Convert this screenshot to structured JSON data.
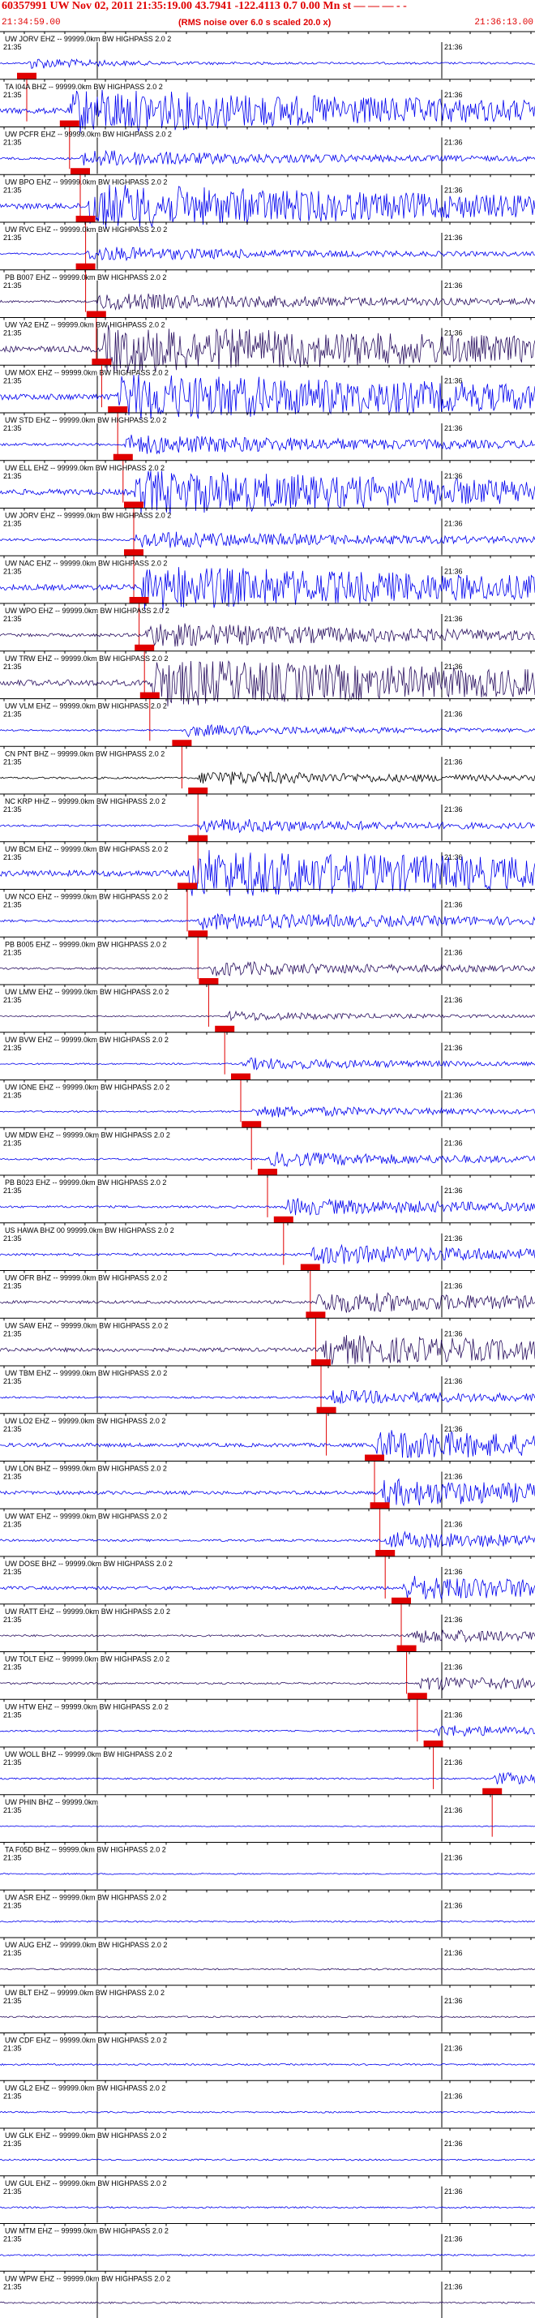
{
  "header": {
    "title": "60357991 UW Nov 02, 2011 21:35:19.00   43.7941 -122.4113  0.7 0.00 Mn st — — — - -",
    "subtitle": "(RMS noise over 6.0 s scaled 20.0 x)",
    "start_time": "21:34:59.00",
    "end_time": "21:36:13.00"
  },
  "colors": {
    "trace_blue": "#0000ee",
    "trace_dark": "#2a1060",
    "trace_black": "#000000",
    "pick": "#e00000",
    "axis": "#000000"
  },
  "tick_labels": {
    "left": "21:35",
    "right": "21:36"
  },
  "channels": [
    {
      "label": "UW JORV EHZ -- 99999.0km BW  HIGHPASS  2.0  2",
      "pick": 0.05,
      "amp": 0.25,
      "burst": 0.5
    },
    {
      "label": "TA I04A BHZ -- 99999.0km BW  HIGHPASS  2.0  2",
      "pick": 0.13,
      "amp": 0.9,
      "burst": 3.0
    },
    {
      "label": "UW PCFR EHZ -- 99999.0km BW  HIGHPASS  2.0  2",
      "pick": 0.15,
      "amp": 0.35,
      "burst": 1.5
    },
    {
      "label": "UW BPO EHZ -- 99999.0km BW  HIGHPASS  2.0  2",
      "pick": 0.16,
      "amp": 0.9,
      "burst": 3.0
    },
    {
      "label": "UW RVC EHZ -- 99999.0km BW  HIGHPASS  2.0  2",
      "pick": 0.16,
      "amp": 0.3,
      "burst": 1.5
    },
    {
      "label": "PB B007 EHZ -- 99999.0km BW  HIGHPASS  2.0  2",
      "pick": 0.18,
      "amp": 0.35,
      "burst": 2.0
    },
    {
      "label": "UW YA2 EHZ -- 99999.0km BW  HIGHPASS  2.0  2",
      "pick": 0.19,
      "amp": 0.95,
      "burst": 3.5
    },
    {
      "label": "UW MOX EHZ -- 99999.0km BW  HIGHPASS  2.0  2",
      "pick": 0.22,
      "amp": 0.95,
      "burst": 3.5
    },
    {
      "label": "UW STD EHZ -- 99999.0km BW  HIGHPASS  2.0  2",
      "pick": 0.23,
      "amp": 0.4,
      "burst": 2.0
    },
    {
      "label": "UW ELL EHZ -- 99999.0km BW  HIGHPASS  2.0  2",
      "pick": 0.25,
      "amp": 0.9,
      "burst": 3.0
    },
    {
      "label": "UW JORV EHZ -- 99999.0km BW  HIGHPASS  2.0  2",
      "pick": 0.25,
      "amp": 0.35,
      "burst": 1.8
    },
    {
      "label": "UW NAC EHZ -- 99999.0km BW  HIGHPASS  2.0  2",
      "pick": 0.26,
      "amp": 0.9,
      "burst": 3.0
    },
    {
      "label": "UW WPO EHZ -- 99999.0km BW  HIGHPASS  2.0  2",
      "pick": 0.27,
      "amp": 0.5,
      "burst": 2.0
    },
    {
      "label": "UW TRW EHZ -- 99999.0km BW  HIGHPASS  2.0  2",
      "pick": 0.28,
      "amp": 0.95,
      "burst": 3.5
    },
    {
      "label": "UW VLM EHZ -- 99999.0km BW  HIGHPASS  2.0  2",
      "pick": 0.34,
      "amp": 0.25,
      "burst": 1.2
    },
    {
      "label": "CN PNT BHZ -- 99999.0km BW  HIGHPASS  2.0  2",
      "pick": 0.37,
      "amp": 0.3,
      "burst": 1.5
    },
    {
      "label": "NC KRP HHZ -- 99999.0km BW  HIGHPASS  2.0  2",
      "pick": 0.37,
      "amp": 0.3,
      "burst": 1.5
    },
    {
      "label": "UW BCM EHZ -- 99999.0km BW  HIGHPASS  2.0  2",
      "pick": 0.35,
      "amp": 0.95,
      "burst": 4.0
    },
    {
      "label": "UW NCO EHZ -- 99999.0km BW  HIGHPASS  2.0  2",
      "pick": 0.37,
      "amp": 0.35,
      "burst": 2.0
    },
    {
      "label": "PB B005 EHZ -- 99999.0km BW  HIGHPASS  2.0  2",
      "pick": 0.39,
      "amp": 0.3,
      "burst": 1.5
    },
    {
      "label": "UW LMW EHZ -- 99999.0km BW  HIGHPASS  2.0  2",
      "pick": 0.42,
      "amp": 0.2,
      "burst": 1.0
    },
    {
      "label": "UW BVW EHZ -- 99999.0km BW  HIGHPASS  2.0  2",
      "pick": 0.45,
      "amp": 0.25,
      "burst": 1.2
    },
    {
      "label": "UW IONE EHZ -- 99999.0km BW  HIGHPASS  2.0  2",
      "pick": 0.47,
      "amp": 0.25,
      "burst": 1.3
    },
    {
      "label": "UW MDW EHZ -- 99999.0km BW  HIGHPASS  2.0  2",
      "pick": 0.5,
      "amp": 0.3,
      "burst": 1.5
    },
    {
      "label": "PB B023 EHZ -- 99999.0km BW  HIGHPASS  2.0  2",
      "pick": 0.53,
      "amp": 0.35,
      "burst": 1.6
    },
    {
      "label": "US HAWA BHZ 00 99999.0km BW  HIGHPASS  2.0  2",
      "pick": 0.58,
      "amp": 0.4,
      "burst": 1.8
    },
    {
      "label": "UW OFR BHZ -- 99999.0km BW  HIGHPASS  2.0  2",
      "pick": 0.59,
      "amp": 0.45,
      "burst": 1.8
    },
    {
      "label": "UW SAW EHZ -- 99999.0km BW  HIGHPASS  2.0  2",
      "pick": 0.6,
      "amp": 0.6,
      "burst": 2.5
    },
    {
      "label": "UW TBM EHZ -- 99999.0km BW  HIGHPASS  2.0  2",
      "pick": 0.61,
      "amp": 0.3,
      "burst": 1.4
    },
    {
      "label": "UW LO2 EHZ -- 99999.0km BW  HIGHPASS  2.0  2",
      "pick": 0.7,
      "amp": 0.6,
      "burst": 2.2
    },
    {
      "label": "UW LON BHZ -- 99999.0km BW  HIGHPASS  2.0  2",
      "pick": 0.71,
      "amp": 0.55,
      "burst": 2.0
    },
    {
      "label": "UW WAT EHZ -- 99999.0km BW  HIGHPASS  2.0  2",
      "pick": 0.72,
      "amp": 0.35,
      "burst": 1.6
    },
    {
      "label": "UW DOSE BHZ -- 99999.0km BW  HIGHPASS  2.0  2",
      "pick": 0.75,
      "amp": 0.5,
      "burst": 2.0
    },
    {
      "label": "UW RATT EHZ -- 99999.0km BW  HIGHPASS  2.0  2",
      "pick": 0.76,
      "amp": 0.3,
      "burst": 1.3
    },
    {
      "label": "UW TOLT EHZ -- 99999.0km BW  HIGHPASS  2.0  2",
      "pick": 0.78,
      "amp": 0.3,
      "burst": 1.3
    },
    {
      "label": "UW HTW EHZ -- 99999.0km BW  HIGHPASS  2.0  2",
      "pick": 0.81,
      "amp": 0.25,
      "burst": 1.0
    },
    {
      "label": "UW WOLL BHZ -- 99999.0km BW  HIGHPASS  2.0  2",
      "pick": 0.92,
      "amp": 0.25,
      "burst": 1.0
    },
    {
      "label": "UW PHIN BHZ -- 99999.0km",
      "pick": null,
      "amp": 0.15,
      "burst": 1.0
    },
    {
      "label": "TA F05D BHZ -- 99999.0km BW  HIGHPASS  2.0  2",
      "pick": null,
      "amp": 0.2,
      "burst": 1.0
    },
    {
      "label": "UW ASR EHZ -- 99999.0km BW  HIGHPASS  2.0  2",
      "pick": null,
      "amp": 0.25,
      "burst": 1.0
    },
    {
      "label": "UW AUG EHZ -- 99999.0km BW  HIGHPASS  2.0  2",
      "pick": null,
      "amp": 0.25,
      "burst": 1.0
    },
    {
      "label": "UW BLT EHZ -- 99999.0km BW  HIGHPASS  2.0  2",
      "pick": null,
      "amp": 0.25,
      "burst": 1.0
    },
    {
      "label": "UW CDF EHZ -- 99999.0km BW  HIGHPASS  2.0  2",
      "pick": null,
      "amp": 0.25,
      "burst": 1.0
    },
    {
      "label": "UW GL2 EHZ -- 99999.0km BW  HIGHPASS  2.0  2",
      "pick": null,
      "amp": 0.25,
      "burst": 1.0
    },
    {
      "label": "UW GLK EHZ -- 99999.0km BW  HIGHPASS  2.0  2",
      "pick": null,
      "amp": 0.25,
      "burst": 1.0
    },
    {
      "label": "UW GUL EHZ -- 99999.0km BW  HIGHPASS  2.0  2",
      "pick": null,
      "amp": 0.25,
      "burst": 1.0
    },
    {
      "label": "UW MTM EHZ -- 99999.0km BW  HIGHPASS  2.0  2",
      "pick": null,
      "amp": 0.25,
      "burst": 1.0
    },
    {
      "label": "UW WPW EHZ -- 99999.0km BW  HIGHPASS  2.0  2",
      "pick": null,
      "amp": 0.25,
      "burst": 1.0
    }
  ]
}
